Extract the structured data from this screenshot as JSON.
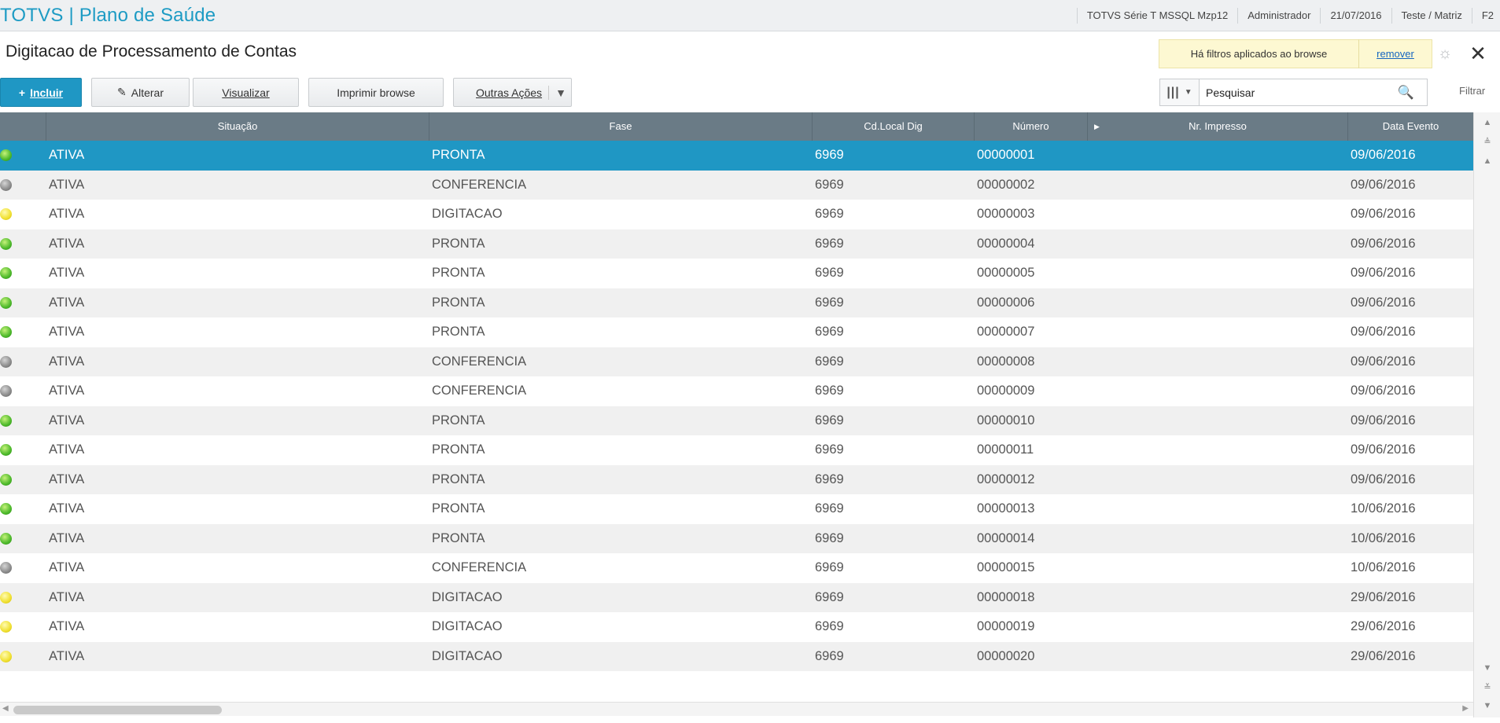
{
  "header": {
    "app_title": "TOTVS | Plano de Saúde",
    "info": [
      "TOTVS Série T  MSSQL Mzp12",
      "Administrador",
      "21/07/2016",
      "Teste / Matriz",
      "F2"
    ]
  },
  "page": {
    "title": "Digitacao de Processamento de Contas",
    "filter_notice": "Há filtros aplicados ao browse",
    "filter_remove": "remover"
  },
  "toolbar": {
    "incluir": "Incluir",
    "alterar": "Alterar",
    "visualizar": "Visualizar",
    "imprimir": "Imprimir browse",
    "outras": "Outras Ações",
    "search_placeholder": "Pesquisar",
    "filtrar": "Filtrar"
  },
  "grid": {
    "columns": [
      "Situação",
      "Fase",
      "Cd.Local Dig",
      "Número",
      "Nr. Impresso",
      "Data Evento"
    ],
    "rows": [
      {
        "status": "green",
        "situacao": "ATIVA",
        "fase": "PRONTA",
        "local": "6969",
        "numero": "00000001",
        "impresso": "",
        "data": "09/06/2016"
      },
      {
        "status": "grey",
        "situacao": "ATIVA",
        "fase": "CONFERENCIA",
        "local": "6969",
        "numero": "00000002",
        "impresso": "",
        "data": "09/06/2016"
      },
      {
        "status": "yellow",
        "situacao": "ATIVA",
        "fase": "DIGITACAO",
        "local": "6969",
        "numero": "00000003",
        "impresso": "",
        "data": "09/06/2016"
      },
      {
        "status": "green",
        "situacao": "ATIVA",
        "fase": "PRONTA",
        "local": "6969",
        "numero": "00000004",
        "impresso": "",
        "data": "09/06/2016"
      },
      {
        "status": "green",
        "situacao": "ATIVA",
        "fase": "PRONTA",
        "local": "6969",
        "numero": "00000005",
        "impresso": "",
        "data": "09/06/2016"
      },
      {
        "status": "green",
        "situacao": "ATIVA",
        "fase": "PRONTA",
        "local": "6969",
        "numero": "00000006",
        "impresso": "",
        "data": "09/06/2016"
      },
      {
        "status": "green",
        "situacao": "ATIVA",
        "fase": "PRONTA",
        "local": "6969",
        "numero": "00000007",
        "impresso": "",
        "data": "09/06/2016"
      },
      {
        "status": "grey",
        "situacao": "ATIVA",
        "fase": "CONFERENCIA",
        "local": "6969",
        "numero": "00000008",
        "impresso": "",
        "data": "09/06/2016"
      },
      {
        "status": "grey",
        "situacao": "ATIVA",
        "fase": "CONFERENCIA",
        "local": "6969",
        "numero": "00000009",
        "impresso": "",
        "data": "09/06/2016"
      },
      {
        "status": "green",
        "situacao": "ATIVA",
        "fase": "PRONTA",
        "local": "6969",
        "numero": "00000010",
        "impresso": "",
        "data": "09/06/2016"
      },
      {
        "status": "green",
        "situacao": "ATIVA",
        "fase": "PRONTA",
        "local": "6969",
        "numero": "00000011",
        "impresso": "",
        "data": "09/06/2016"
      },
      {
        "status": "green",
        "situacao": "ATIVA",
        "fase": "PRONTA",
        "local": "6969",
        "numero": "00000012",
        "impresso": "",
        "data": "09/06/2016"
      },
      {
        "status": "green",
        "situacao": "ATIVA",
        "fase": "PRONTA",
        "local": "6969",
        "numero": "00000013",
        "impresso": "",
        "data": "10/06/2016"
      },
      {
        "status": "green",
        "situacao": "ATIVA",
        "fase": "PRONTA",
        "local": "6969",
        "numero": "00000014",
        "impresso": "",
        "data": "10/06/2016"
      },
      {
        "status": "grey",
        "situacao": "ATIVA",
        "fase": "CONFERENCIA",
        "local": "6969",
        "numero": "00000015",
        "impresso": "",
        "data": "10/06/2016"
      },
      {
        "status": "yellow",
        "situacao": "ATIVA",
        "fase": "DIGITACAO",
        "local": "6969",
        "numero": "00000018",
        "impresso": "",
        "data": "29/06/2016"
      },
      {
        "status": "yellow",
        "situacao": "ATIVA",
        "fase": "DIGITACAO",
        "local": "6969",
        "numero": "00000019",
        "impresso": "",
        "data": "29/06/2016"
      },
      {
        "status": "yellow",
        "situacao": "ATIVA",
        "fase": "DIGITACAO",
        "local": "6969",
        "numero": "00000020",
        "impresso": "",
        "data": "29/06/2016"
      }
    ]
  }
}
